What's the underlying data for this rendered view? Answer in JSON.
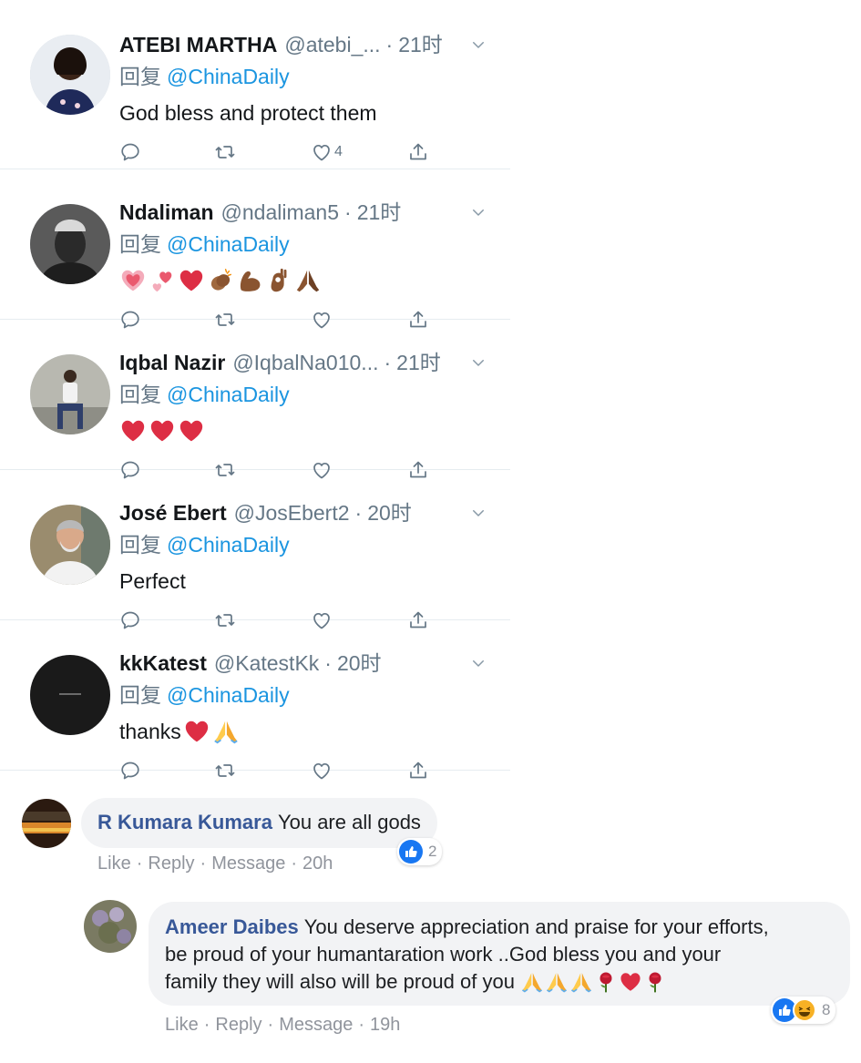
{
  "tweets": [
    {
      "name": "ATEBI MARTHA",
      "handle": "@atebi_...",
      "time": "21时",
      "reply_prefix": "回复",
      "reply_to": "@ChinaDaily",
      "text": "God bless and protect them",
      "like_count": "4",
      "avatar_icon": "avatar-woman-photo"
    },
    {
      "name": "Ndaliman",
      "handle": "@ndaliman5",
      "time": "21时",
      "reply_prefix": "回复",
      "reply_to": "@ChinaDaily",
      "emojis": [
        "sparkling-heart",
        "two-hearts",
        "red-heart",
        "clapping-hands",
        "flexed-biceps",
        "ok-hand",
        "folded-hands"
      ],
      "avatar_icon": "avatar-man-cap-photo"
    },
    {
      "name": "Iqbal Nazir",
      "handle": "@IqbalNa010...",
      "time": "21时",
      "reply_prefix": "回复",
      "reply_to": "@ChinaDaily",
      "emojis": [
        "red-heart",
        "red-heart",
        "red-heart"
      ],
      "avatar_icon": "avatar-man-sitting-photo"
    },
    {
      "name": "José Ebert",
      "handle": "@JosEbert2",
      "time": "20时",
      "reply_prefix": "回复",
      "reply_to": "@ChinaDaily",
      "text": "Perfect",
      "avatar_icon": "avatar-older-man-photo"
    },
    {
      "name": "kkKatest",
      "handle": "@KatestKk",
      "time": "20时",
      "reply_prefix": "回复",
      "reply_to": "@ChinaDaily",
      "text": "thanks",
      "emojis": [
        "red-heart",
        "folded-hands"
      ],
      "avatar_icon": "avatar-dark-circle"
    }
  ],
  "fb_comments": [
    {
      "name": "R Kumara Kumara",
      "text": "You are all gods",
      "actions": [
        "Like",
        "Reply",
        "Message"
      ],
      "time": "20h",
      "reaction_count": "2",
      "reactions": [
        "like"
      ]
    },
    {
      "name": "Ameer Daibes",
      "text_line1": "You deserve appreciation and praise for your efforts,",
      "text_line2": "be proud of your humantaration work ..God bless you and your",
      "text_line3": "family they will also will be proud of you",
      "emojis": [
        "folded-hands",
        "folded-hands",
        "folded-hands",
        "rose",
        "red-heart",
        "rose"
      ],
      "actions": [
        "Like",
        "Reply",
        "Message"
      ],
      "time": "19h",
      "reaction_count": "8",
      "reactions": [
        "like",
        "haha"
      ]
    }
  ],
  "colors": {
    "twitter_blue": "#1b95e0",
    "twitter_gray": "#657786",
    "fb_name": "#385898",
    "fb_bubble": "#f2f3f5",
    "fb_link": "#90949c",
    "fb_like": "#1877f2"
  }
}
